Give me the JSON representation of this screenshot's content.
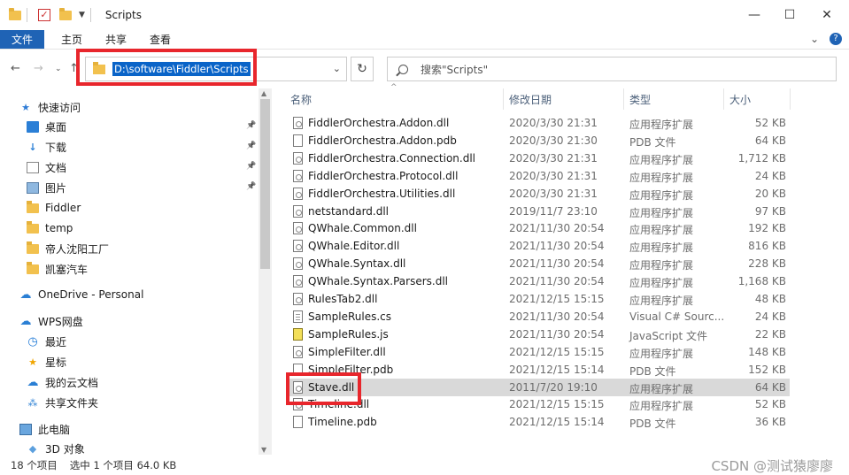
{
  "window": {
    "title": "Scripts",
    "minimize": "—",
    "maximize": "☐",
    "close": "✕"
  },
  "ribbon": {
    "tabs": [
      "文件",
      "主页",
      "共享",
      "查看"
    ],
    "expand": "⌄",
    "help": "?"
  },
  "address": {
    "path": "D:\\software\\Fiddler\\Scripts",
    "search_placeholder": "搜索\"Scripts\""
  },
  "sidebar": {
    "items": [
      {
        "label": "快速访问",
        "icon": "star-icon",
        "pinned": false
      },
      {
        "label": "桌面",
        "icon": "desktop-icon",
        "pinned": true
      },
      {
        "label": "下载",
        "icon": "download-icon",
        "pinned": true
      },
      {
        "label": "文档",
        "icon": "document-icon",
        "pinned": true
      },
      {
        "label": "图片",
        "icon": "picture-icon",
        "pinned": true
      },
      {
        "label": "Fiddler",
        "icon": "folder-icon",
        "pinned": false
      },
      {
        "label": "temp",
        "icon": "folder-icon",
        "pinned": false
      },
      {
        "label": "帝人沈阳工厂",
        "icon": "folder-icon",
        "pinned": false
      },
      {
        "label": "凯塞汽车",
        "icon": "folder-icon",
        "pinned": false
      },
      {
        "label": "OneDrive - Personal",
        "icon": "cloud-icon",
        "pinned": false
      },
      {
        "label": "WPS网盘",
        "icon": "cloud-icon",
        "pinned": false
      },
      {
        "label": "最近",
        "icon": "clock-icon",
        "pinned": false
      },
      {
        "label": "星标",
        "icon": "star-icon",
        "pinned": false
      },
      {
        "label": "我的云文档",
        "icon": "cloud-doc-icon",
        "pinned": false
      },
      {
        "label": "共享文件夹",
        "icon": "share-icon",
        "pinned": false
      },
      {
        "label": "此电脑",
        "icon": "computer-icon",
        "pinned": false
      },
      {
        "label": "3D 对象",
        "icon": "cube-icon",
        "pinned": false
      }
    ]
  },
  "columns": {
    "name": "名称",
    "date": "修改日期",
    "type": "类型",
    "size": "大小"
  },
  "files": [
    {
      "name": "FiddlerOrchestra.Addon.dll",
      "date": "2020/3/30 21:31",
      "type": "应用程序扩展",
      "size": "52 KB",
      "kind": "dll"
    },
    {
      "name": "FiddlerOrchestra.Addon.pdb",
      "date": "2020/3/30 21:30",
      "type": "PDB 文件",
      "size": "64 KB",
      "kind": "pdb"
    },
    {
      "name": "FiddlerOrchestra.Connection.dll",
      "date": "2020/3/30 21:31",
      "type": "应用程序扩展",
      "size": "1,712 KB",
      "kind": "dll"
    },
    {
      "name": "FiddlerOrchestra.Protocol.dll",
      "date": "2020/3/30 21:31",
      "type": "应用程序扩展",
      "size": "24 KB",
      "kind": "dll"
    },
    {
      "name": "FiddlerOrchestra.Utilities.dll",
      "date": "2020/3/30 21:31",
      "type": "应用程序扩展",
      "size": "20 KB",
      "kind": "dll"
    },
    {
      "name": "netstandard.dll",
      "date": "2019/11/7 23:10",
      "type": "应用程序扩展",
      "size": "97 KB",
      "kind": "dll"
    },
    {
      "name": "QWhale.Common.dll",
      "date": "2021/11/30 20:54",
      "type": "应用程序扩展",
      "size": "192 KB",
      "kind": "dll"
    },
    {
      "name": "QWhale.Editor.dll",
      "date": "2021/11/30 20:54",
      "type": "应用程序扩展",
      "size": "816 KB",
      "kind": "dll"
    },
    {
      "name": "QWhale.Syntax.dll",
      "date": "2021/11/30 20:54",
      "type": "应用程序扩展",
      "size": "228 KB",
      "kind": "dll"
    },
    {
      "name": "QWhale.Syntax.Parsers.dll",
      "date": "2021/11/30 20:54",
      "type": "应用程序扩展",
      "size": "1,168 KB",
      "kind": "dll"
    },
    {
      "name": "RulesTab2.dll",
      "date": "2021/12/15 15:15",
      "type": "应用程序扩展",
      "size": "48 KB",
      "kind": "dll"
    },
    {
      "name": "SampleRules.cs",
      "date": "2021/11/30 20:54",
      "type": "Visual C# Sourc...",
      "size": "24 KB",
      "kind": "cs"
    },
    {
      "name": "SampleRules.js",
      "date": "2021/11/30 20:54",
      "type": "JavaScript 文件",
      "size": "22 KB",
      "kind": "js"
    },
    {
      "name": "SimpleFilter.dll",
      "date": "2021/12/15 15:15",
      "type": "应用程序扩展",
      "size": "148 KB",
      "kind": "dll"
    },
    {
      "name": "SimpleFilter.pdb",
      "date": "2021/12/15 15:14",
      "type": "PDB 文件",
      "size": "152 KB",
      "kind": "pdb"
    },
    {
      "name": "Stave.dll",
      "date": "2011/7/20 19:10",
      "type": "应用程序扩展",
      "size": "64 KB",
      "kind": "dll",
      "selected": true
    },
    {
      "name": "Timeline.dll",
      "date": "2021/12/15 15:15",
      "type": "应用程序扩展",
      "size": "52 KB",
      "kind": "dll"
    },
    {
      "name": "Timeline.pdb",
      "date": "2021/12/15 15:14",
      "type": "PDB 文件",
      "size": "36 KB",
      "kind": "pdb"
    }
  ],
  "status": {
    "count": "18 个项目",
    "selection": "选中 1 个项目  64.0 KB",
    "watermark": "CSDN @测试猿廖廖"
  },
  "colors": {
    "accent": "#1f63b5",
    "highlight_frame": "#e8262c",
    "selection_row": "#d9d9d9"
  }
}
